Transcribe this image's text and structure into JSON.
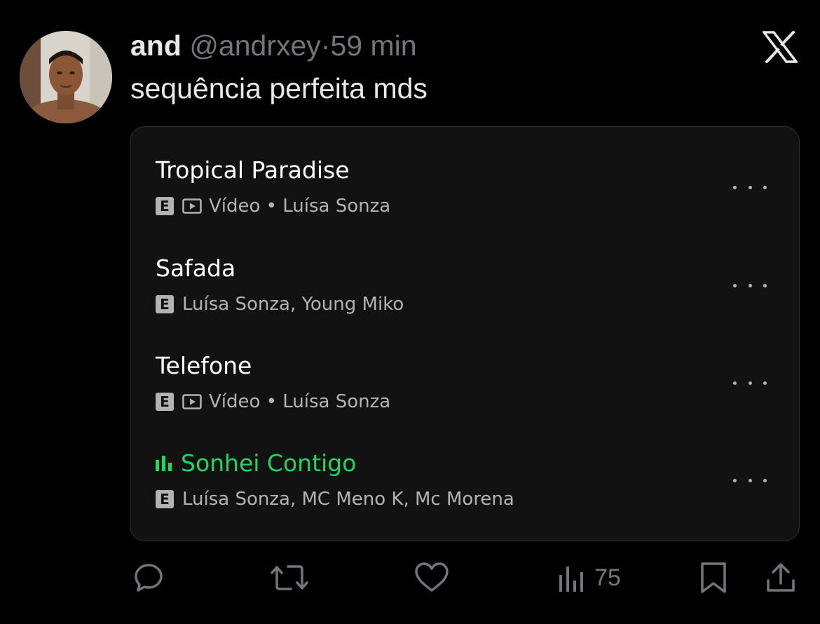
{
  "tweet": {
    "display_name": "and",
    "handle": "@andrxey",
    "separator": "·",
    "time": "59 min",
    "text": "sequência perfeita mds",
    "avatar_icon": "avatar",
    "logo_icon": "x-logo-icon"
  },
  "card": {
    "tracks": [
      {
        "title": "Tropical Paradise",
        "explicit": "E",
        "has_video": true,
        "meta": "Vídeo • Luísa Sonza",
        "playing": false
      },
      {
        "title": "Safada",
        "explicit": "E",
        "has_video": false,
        "meta": "Luísa Sonza, Young Miko",
        "playing": false
      },
      {
        "title": "Telefone",
        "explicit": "E",
        "has_video": true,
        "meta": "Vídeo • Luísa Sonza",
        "playing": false
      },
      {
        "title": "Sonhei Contigo",
        "explicit": "E",
        "has_video": false,
        "meta": "Luísa Sonza, MC Meno K, Mc Morena",
        "playing": true
      }
    ]
  },
  "actions": {
    "reply_icon": "reply-icon",
    "retweet_icon": "retweet-icon",
    "like_icon": "heart-icon",
    "views_icon": "views-icon",
    "views_count": "75",
    "bookmark_icon": "bookmark-icon",
    "share_icon": "share-icon"
  },
  "colors": {
    "background": "#000000",
    "card_background": "#121212",
    "primary_text": "#e7e9ea",
    "secondary_text": "#71767b",
    "playing_green": "#1ed760",
    "meta_text": "#b3b3b3"
  }
}
